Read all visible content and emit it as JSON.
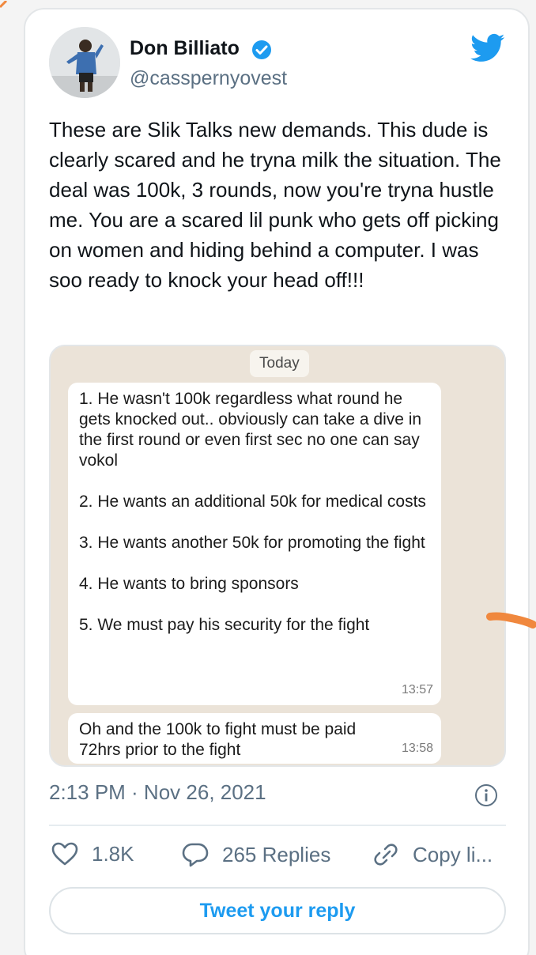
{
  "tweet": {
    "display_name": "Don Billiato",
    "handle": "@casspernyovest",
    "text": "These are Slik Talks new demands. This  dude is clearly scared and he tryna milk the situation. The deal was 100k, 3 rounds, now you're tryna hustle me. You are a scared lil punk who gets off picking on women and hiding behind a computer. I was soo ready to knock your head off!!!",
    "timestamp": "2:13 PM · Nov 26, 2021"
  },
  "chat": {
    "day_label": "Today",
    "message1": {
      "items": [
        "1. He wasn't 100k regardless what round he gets knocked out.. obviously can take a dive in the first round or even first sec no one can say vokol",
        "2. He wants an additional 50k for medical costs",
        "3. He wants another 50k for promoting the fight",
        "4. He wants to bring sponsors",
        "5. We must pay his security for the fight"
      ],
      "time": "13:57"
    },
    "message2": {
      "text": "Oh and the 100k to fight must be paid 72hrs prior to the fight",
      "time": "13:58"
    }
  },
  "actions": {
    "likes": "1.8K",
    "replies": "265 Replies",
    "copy": "Copy li..."
  },
  "reply_button_label": "Tweet your reply",
  "icons": {
    "verified": "verified-badge-icon",
    "brand": "twitter-bird-icon",
    "info": "info-icon",
    "like": "heart-icon",
    "reply": "speech-bubble-icon",
    "copy": "link-icon"
  },
  "colors": {
    "accent": "#1d9bf0",
    "secondary_text": "#5b7083",
    "chat_background": "#ebe3d8",
    "annotation": "#f0883e"
  }
}
